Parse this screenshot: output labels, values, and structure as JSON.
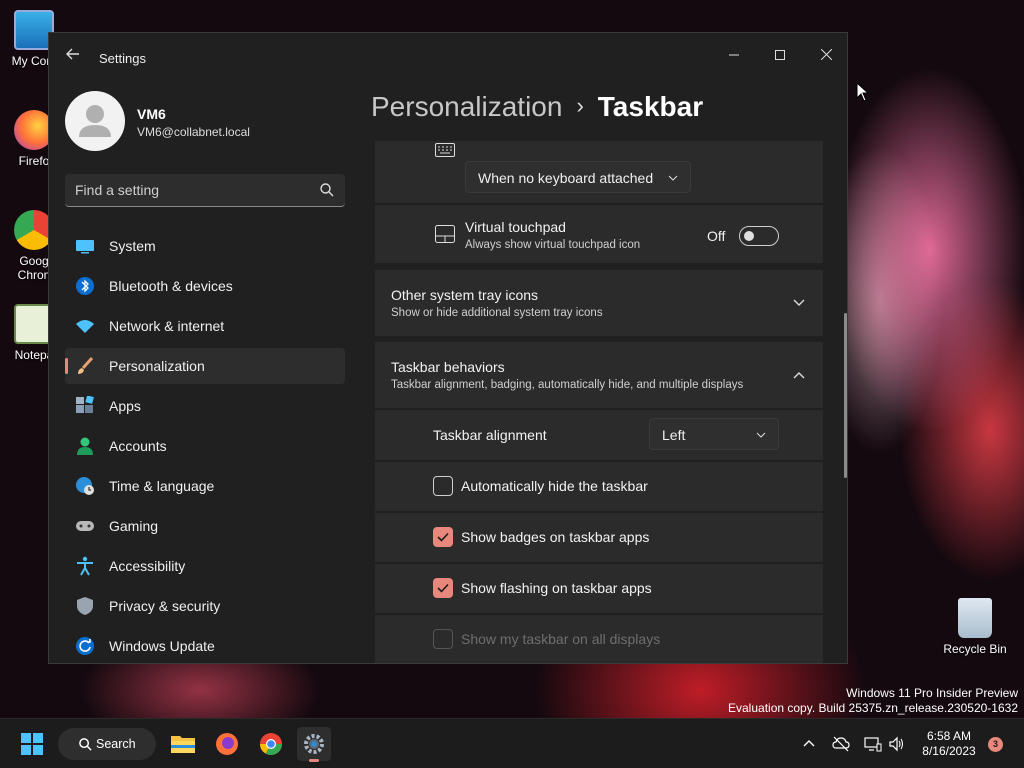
{
  "desktop": {
    "icons": [
      {
        "label": "My Com"
      },
      {
        "label": "Firefo"
      },
      {
        "label": "Goog Chron"
      },
      {
        "label": "Notepa"
      },
      {
        "label": "Recycle Bin"
      }
    ],
    "watermark_line1": "Windows 11 Pro Insider Preview",
    "watermark_line2": "Evaluation copy. Build 25375.zn_release.230520-1632"
  },
  "window": {
    "title": "Settings",
    "controls": {
      "minimize": "—",
      "maximize": "☐",
      "close": "✕"
    }
  },
  "profile": {
    "name": "VM6",
    "email": "VM6@collabnet.local"
  },
  "search": {
    "placeholder": "Find a setting"
  },
  "nav": {
    "items": [
      {
        "label": "System"
      },
      {
        "label": "Bluetooth & devices"
      },
      {
        "label": "Network & internet"
      },
      {
        "label": "Personalization"
      },
      {
        "label": "Apps"
      },
      {
        "label": "Accounts"
      },
      {
        "label": "Time & language"
      },
      {
        "label": "Gaming"
      },
      {
        "label": "Accessibility"
      },
      {
        "label": "Privacy & security"
      },
      {
        "label": "Windows Update"
      }
    ]
  },
  "breadcrumb": {
    "parent": "Personalization",
    "separator": "›",
    "current": "Taskbar"
  },
  "content": {
    "keyboard_dropdown": "When no keyboard attached",
    "virtual_touchpad": {
      "title": "Virtual touchpad",
      "subtitle": "Always show virtual touchpad icon",
      "state_label": "Off"
    },
    "other_tray": {
      "title": "Other system tray icons",
      "subtitle": "Show or hide additional system tray icons"
    },
    "behaviors": {
      "title": "Taskbar behaviors",
      "subtitle": "Taskbar alignment, badging, automatically hide, and multiple displays",
      "alignment_label": "Taskbar alignment",
      "alignment_value": "Left",
      "auto_hide": "Automatically hide the taskbar",
      "badges": "Show badges on taskbar apps",
      "flashing": "Show flashing on taskbar apps",
      "all_displays": "Show my taskbar on all displays"
    }
  },
  "taskbar": {
    "search_label": "Search",
    "time": "6:58 AM",
    "date": "8/16/2023",
    "notification_count": "3"
  },
  "colors": {
    "accent": "#e8877b",
    "window_bg": "#202020",
    "card_bg": "#2b2b2b"
  }
}
